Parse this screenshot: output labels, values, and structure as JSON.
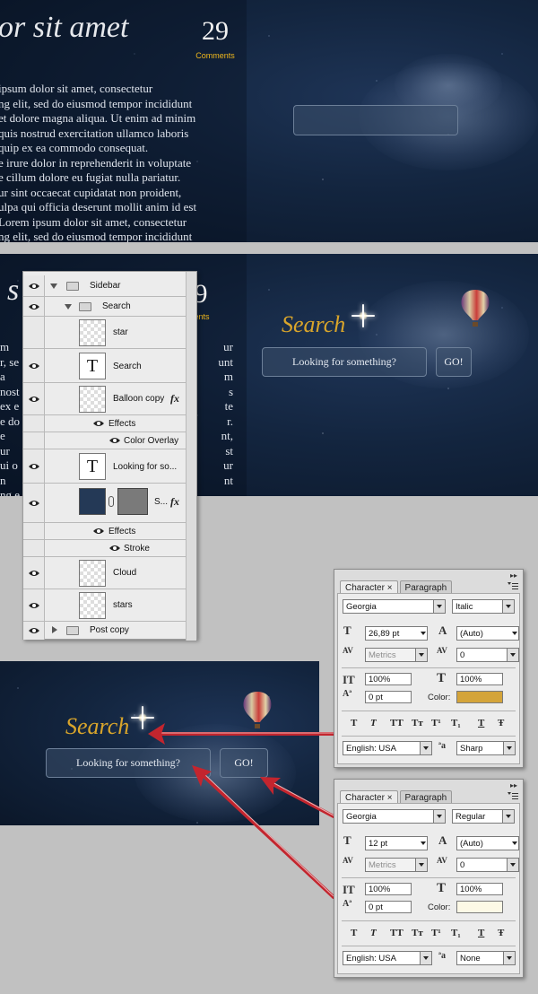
{
  "top_section": {
    "post_title": "or sit amet",
    "comments_count": "29",
    "comments_label": "Comments",
    "post_body": "ipsum dolor sit amet, consectetur\nng elit, sed do eiusmod tempor incididunt\net dolore magna aliqua. Ut enim ad minim\nquis nostrud exercitation ullamco laboris\nquip ex ea commodo consequat.\ne irure dolor in reprehenderit in voluptate\ne cillum dolore eu fugiat nulla pariatur.\nur sint occaecat cupidatat non proident,\nulpa qui officia deserunt mollit anim id est\n Lorem ipsum dolor sit amet, consectetur\nng elit, sed do eiusmod tempor incididunt"
  },
  "middle_section": {
    "title_fragment": "s",
    "comments_fragment": "9",
    "comments_label_fragment": "ents",
    "left_text_fragments": [
      "m",
      "r, se",
      "a",
      "nost",
      "ex e",
      "e do",
      "e",
      "ur",
      "ui o",
      "n",
      "ng e"
    ],
    "right_text_fragments": [
      "ur",
      "unt",
      "m",
      "s",
      "te",
      "r.",
      "nt,",
      "st",
      "ur",
      "nt"
    ],
    "search_heading": "Search",
    "search_placeholder": "Looking for something?",
    "go_label": "GO!"
  },
  "layers_panel": {
    "rows": [
      {
        "name": "Sidebar",
        "type": "group",
        "expanded": true
      },
      {
        "name": "Search",
        "type": "group",
        "expanded": true
      },
      {
        "name": "star",
        "type": "raster"
      },
      {
        "name": "Search",
        "type": "text"
      },
      {
        "name": "Balloon copy",
        "type": "raster",
        "fx": "fx"
      },
      {
        "name": "Effects",
        "type": "effects"
      },
      {
        "name": "Color Overlay",
        "type": "effect"
      },
      {
        "name": "Looking for so...",
        "type": "text"
      },
      {
        "name": "S...",
        "type": "shape",
        "fx": "fx"
      },
      {
        "name": "Effects",
        "type": "effects"
      },
      {
        "name": "Stroke",
        "type": "effect"
      },
      {
        "name": "Cloud",
        "type": "raster"
      },
      {
        "name": "stars",
        "type": "raster"
      },
      {
        "name": "Post copy",
        "type": "group",
        "expanded": false
      }
    ],
    "text_thumb_glyph": "T"
  },
  "bottom_section": {
    "search_heading": "Search",
    "search_placeholder": "Looking for something?",
    "go_label": "GO!"
  },
  "character_panels": [
    {
      "tab_character": "Character",
      "tab_paragraph": "Paragraph",
      "close_glyph": "×",
      "font_family": "Georgia",
      "font_style": "Italic",
      "font_size": "26,89 pt",
      "leading": "(Auto)",
      "kerning": "Metrics",
      "tracking": "0",
      "vertical_scale": "100%",
      "horizontal_scale": "100%",
      "baseline_shift": "0 pt",
      "color_label": "Color:",
      "color": "#d4a43a",
      "language": "English: USA",
      "antialias": "Sharp"
    },
    {
      "tab_character": "Character",
      "tab_paragraph": "Paragraph",
      "close_glyph": "×",
      "font_family": "Georgia",
      "font_style": "Regular",
      "font_size": "12 pt",
      "leading": "(Auto)",
      "kerning": "Metrics",
      "tracking": "0",
      "vertical_scale": "100%",
      "horizontal_scale": "100%",
      "baseline_shift": "0 pt",
      "color_label": "Color:",
      "color": "#fdf9e6",
      "language": "English: USA",
      "antialias": "None"
    }
  ],
  "type_style_glyphs": [
    "T",
    "T",
    "TT",
    "Tт",
    "T¹",
    "T₁",
    "T",
    "Ŧ"
  ],
  "icon_glyphs": {
    "font_size": "T",
    "leading": "A",
    "kerning": "AV",
    "tracking": "AV",
    "vertical_scale": "IT",
    "horizontal_scale": "T",
    "baseline_shift": "Aª",
    "antialias": "ªa"
  },
  "colors": {
    "accent_gold": "#d9a52b",
    "sky_dark": "#0b1729",
    "arrow_red": "#c3252e",
    "comments_yellow": "#f0b81c"
  }
}
